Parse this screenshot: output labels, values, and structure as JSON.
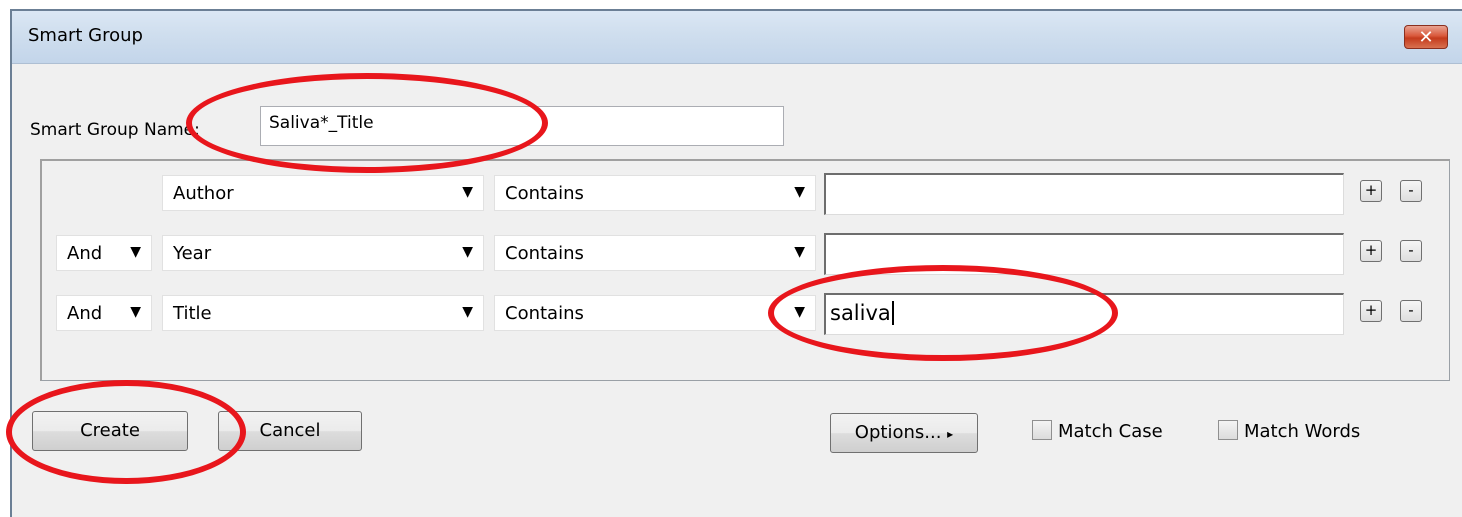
{
  "window": {
    "title": "Smart Group",
    "close_label": "✕"
  },
  "name_field": {
    "label": "Smart Group Name:",
    "value": "Saliva*_Title"
  },
  "rows": [
    {
      "connector": "",
      "field": "Author",
      "operator": "Contains",
      "value": ""
    },
    {
      "connector": "And",
      "field": "Year",
      "operator": "Contains",
      "value": ""
    },
    {
      "connector": "And",
      "field": "Title",
      "operator": "Contains",
      "value": "saliva"
    }
  ],
  "row_buttons": {
    "add": "+",
    "remove": "-"
  },
  "buttons": {
    "create": "Create",
    "cancel": "Cancel",
    "options": "Options...",
    "options_arrow": "▸"
  },
  "checkboxes": {
    "match_case": "Match Case",
    "match_words": "Match Words"
  },
  "annotations": {
    "color": "#e8161c"
  }
}
